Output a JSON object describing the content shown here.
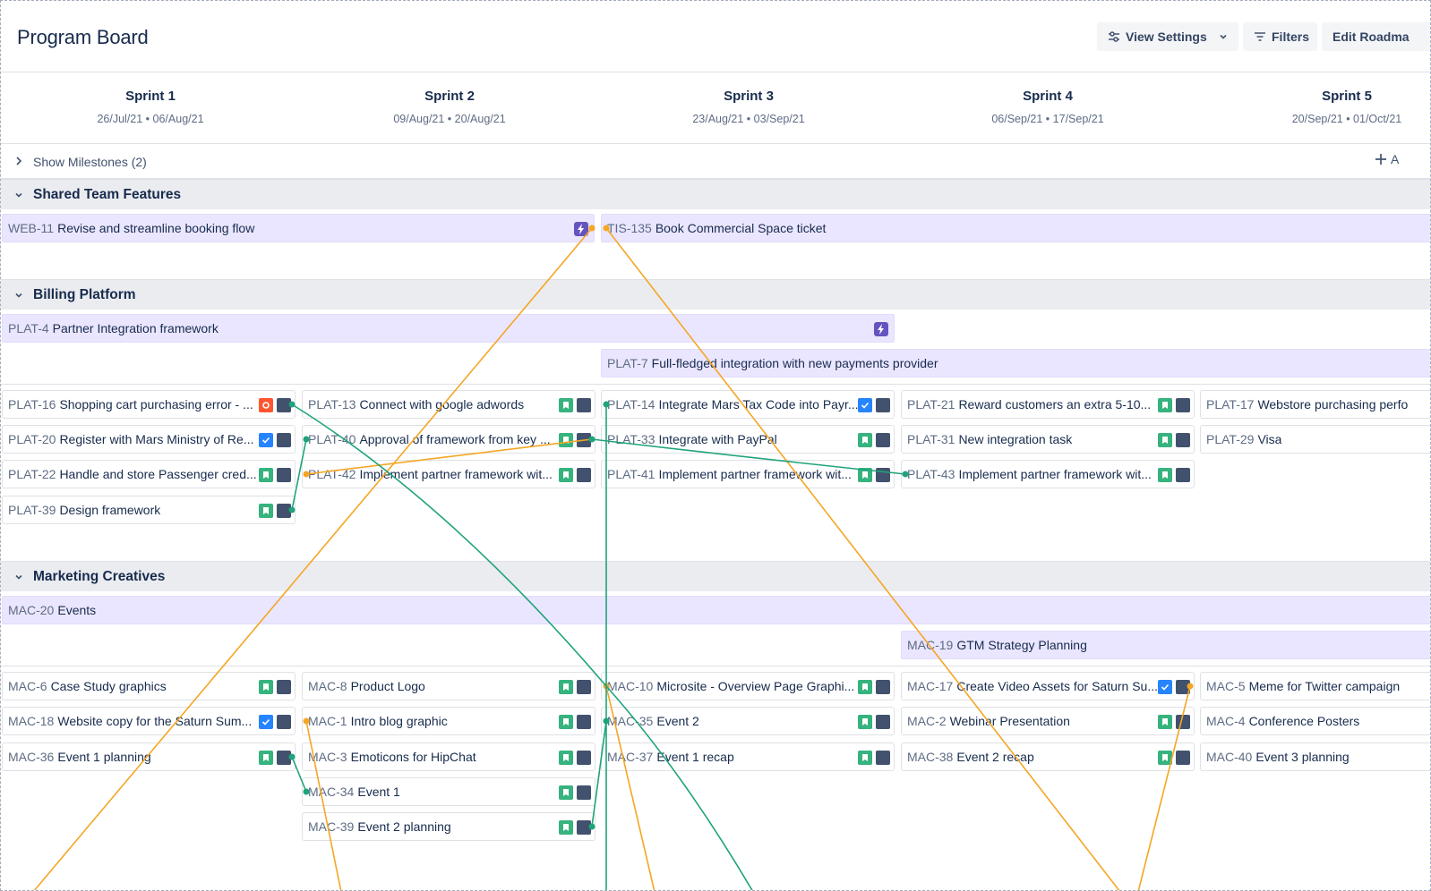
{
  "page": {
    "title": "Program Board"
  },
  "toolbar": {
    "view_settings": "View Settings",
    "filters": "Filters",
    "edit_roadmap": "Edit Roadma"
  },
  "sprints": [
    {
      "name": "Sprint 1",
      "dates": "26/Jul/21 • 06/Aug/21"
    },
    {
      "name": "Sprint 2",
      "dates": "09/Aug/21 • 20/Aug/21"
    },
    {
      "name": "Sprint 3",
      "dates": "23/Aug/21 • 03/Sep/21"
    },
    {
      "name": "Sprint 4",
      "dates": "06/Sep/21 • 17/Sep/21"
    },
    {
      "name": "Sprint 5",
      "dates": "20/Sep/21 • 01/Oct/21"
    }
  ],
  "milestones": {
    "label": "Show Milestones (2)",
    "add_label": "A"
  },
  "teams": [
    {
      "name": "Shared Team Features"
    },
    {
      "name": "Billing Platform"
    },
    {
      "name": "Marketing Creatives"
    }
  ],
  "features": {
    "web11": {
      "key": "WEB-11",
      "title": "Revise and streamline booking flow"
    },
    "tis135": {
      "key": "TIS-135",
      "title": "Book Commercial Space ticket"
    },
    "plat4": {
      "key": "PLAT-4",
      "title": "Partner Integration framework"
    },
    "plat7": {
      "key": "PLAT-7",
      "title": "Full-fledged integration with new payments provider"
    },
    "mac20": {
      "key": "MAC-20",
      "title": "Events"
    },
    "mac19": {
      "key": "MAC-19",
      "title": "GTM Strategy Planning"
    }
  },
  "cards": {
    "plat16": {
      "key": "PLAT-16",
      "title": "Shopping cart purchasing error - ...",
      "type": "bug"
    },
    "plat20": {
      "key": "PLAT-20",
      "title": "Register with Mars Ministry of Re...",
      "type": "task"
    },
    "plat22": {
      "key": "PLAT-22",
      "title": "Handle and store Passenger cred...",
      "type": "story"
    },
    "plat39": {
      "key": "PLAT-39",
      "title": "Design framework",
      "type": "story"
    },
    "plat13": {
      "key": "PLAT-13",
      "title": "Connect with google adwords",
      "type": "story"
    },
    "plat40": {
      "key": "PLAT-40",
      "title": "Approval of framework from key ...",
      "type": "story"
    },
    "plat42": {
      "key": "PLAT-42",
      "title": "Implement partner framework wit...",
      "type": "story"
    },
    "plat14": {
      "key": "PLAT-14",
      "title": "Integrate Mars Tax Code into Payr...",
      "type": "task"
    },
    "plat33": {
      "key": "PLAT-33",
      "title": "Integrate with PayPal",
      "type": "story"
    },
    "plat41": {
      "key": "PLAT-41",
      "title": "Implement partner framework wit...",
      "type": "story"
    },
    "plat21": {
      "key": "PLAT-21",
      "title": "Reward customers an extra 5-10...",
      "type": "story"
    },
    "plat31": {
      "key": "PLAT-31",
      "title": "New integration task",
      "type": "story"
    },
    "plat43": {
      "key": "PLAT-43",
      "title": "Implement partner framework wit...",
      "type": "story"
    },
    "plat17": {
      "key": "PLAT-17",
      "title": "Webstore purchasing perfo",
      "type": "none"
    },
    "plat29": {
      "key": "PLAT-29",
      "title": "Visa",
      "type": "none"
    },
    "mac6": {
      "key": "MAC-6",
      "title": "Case Study graphics",
      "type": "story"
    },
    "mac18": {
      "key": "MAC-18",
      "title": "Website copy for the Saturn Sum...",
      "type": "task"
    },
    "mac36": {
      "key": "MAC-36",
      "title": "Event 1 planning",
      "type": "story"
    },
    "mac8": {
      "key": "MAC-8",
      "title": "Product Logo",
      "type": "story"
    },
    "mac1": {
      "key": "MAC-1",
      "title": "Intro blog graphic",
      "type": "story"
    },
    "mac3": {
      "key": "MAC-3",
      "title": "Emoticons for HipChat",
      "type": "story"
    },
    "mac34": {
      "key": "MAC-34",
      "title": "Event 1",
      "type": "story"
    },
    "mac39": {
      "key": "MAC-39",
      "title": "Event 2 planning",
      "type": "story"
    },
    "mac10": {
      "key": "MAC-10",
      "title": "Microsite - Overview Page Graphi...",
      "type": "story"
    },
    "mac35": {
      "key": "MAC-35",
      "title": "Event 2",
      "type": "story"
    },
    "mac37": {
      "key": "MAC-37",
      "title": "Event 1 recap",
      "type": "story"
    },
    "mac17": {
      "key": "MAC-17",
      "title": "Create Video Assets for Saturn Su...",
      "type": "task"
    },
    "mac2": {
      "key": "MAC-2",
      "title": "Webinar Presentation",
      "type": "story"
    },
    "mac38": {
      "key": "MAC-38",
      "title": "Event 2 recap",
      "type": "story"
    },
    "mac5": {
      "key": "MAC-5",
      "title": "Meme for Twitter campaign",
      "type": "none"
    },
    "mac4": {
      "key": "MAC-4",
      "title": "Conference Posters",
      "type": "none"
    },
    "mac40": {
      "key": "MAC-40",
      "title": "Event 3 planning",
      "type": "none"
    }
  },
  "colors": {
    "dependency_green": "#1fa37a",
    "dependency_orange": "#f5a623",
    "feature_bg": "#eae6ff",
    "story": "#36b37e",
    "task": "#2684ff",
    "bug": "#ff5630",
    "epic": "#6554c0"
  },
  "icons": {
    "view_settings": "sliders-icon",
    "filters": "filter-icon",
    "expand": "chevron-right-icon",
    "collapse": "chevron-down-icon",
    "add": "plus-icon",
    "epic": "lightning-icon",
    "story": "bookmark-icon",
    "task": "checkbox-icon",
    "bug": "stop-icon",
    "assignee": "avatar-icon"
  }
}
